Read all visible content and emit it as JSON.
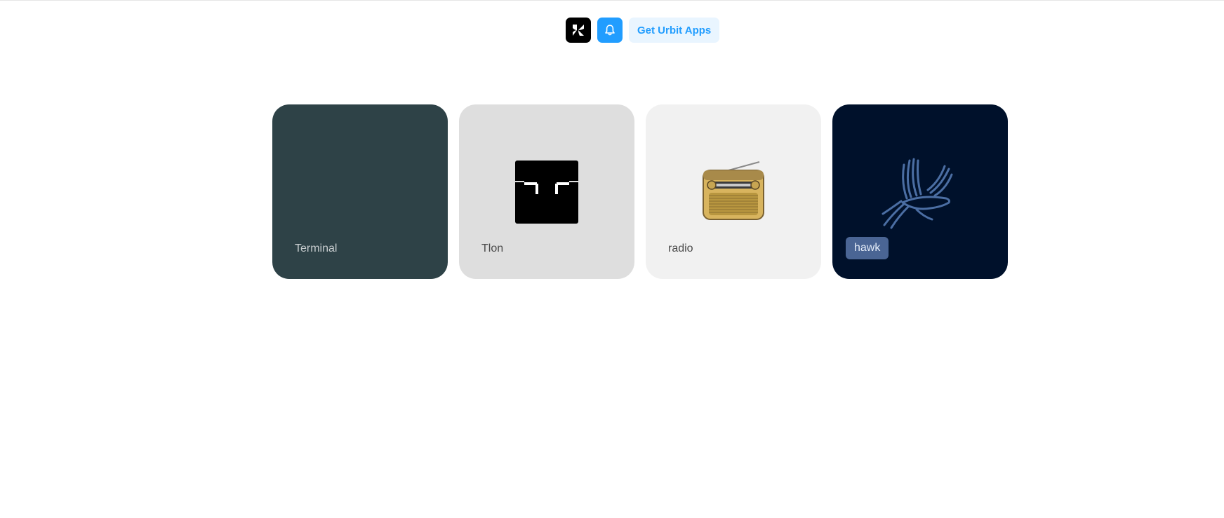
{
  "topbar": {
    "leap_icon": "leap-icon",
    "notifications_icon": "bell-icon",
    "get_apps_label": "Get Urbit Apps",
    "colors": {
      "leap_bg": "#000000",
      "notifications_bg": "#219dff",
      "get_apps_bg": "#e9f5ff",
      "get_apps_text": "#219dff"
    }
  },
  "tiles": [
    {
      "label": "Terminal",
      "color": "#2e4247"
    },
    {
      "label": "Tlon",
      "icon": "tlon-logo-icon",
      "color": "#dedede"
    },
    {
      "label": "radio",
      "icon": "radio-icon",
      "color": "#f1f1f1"
    },
    {
      "label": "hawk",
      "icon": "hawk-icon",
      "color": "#00112b"
    }
  ]
}
